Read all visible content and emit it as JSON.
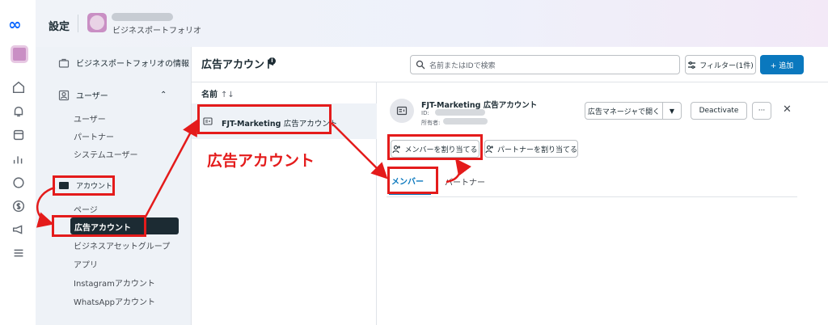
{
  "header": {
    "title": "設定",
    "business_name": "ビジネスポートフォリオ"
  },
  "rail": {
    "icons": [
      "meta-logo-icon",
      "home-icon",
      "bell-icon",
      "pages-icon",
      "chart-icon",
      "chat-icon",
      "dollar-icon",
      "megaphone-icon",
      "menu-icon"
    ]
  },
  "sidebar": {
    "business_info": "ビジネスポートフォリオの情報",
    "users": {
      "label": "ユーザー",
      "items": [
        "ユーザー",
        "パートナー",
        "システムユーザー"
      ]
    },
    "accounts": {
      "label": "アカウント",
      "items": [
        "ページ",
        "広告アカウント",
        "ビジネスアセットグループ",
        "アプリ",
        "Instagramアカウント",
        "WhatsAppアカウント"
      ]
    }
  },
  "main": {
    "title": "広告アカウント",
    "search_placeholder": "名前またはIDで検索",
    "filter_label": "フィルター(1件)",
    "add_label": "+ 追加",
    "list_header": "名前",
    "list_sort": "↑↓",
    "list_item_name": "FJT-Marketing",
    "list_item_suffix": "広告アカウント"
  },
  "detail": {
    "name": "FJT-Marketing 広告アカウント",
    "id_label": "ID:",
    "owner_label": "所有者:",
    "open_ads_manager": "広告マネージャで開く",
    "dropdown": "▼",
    "deactivate": "Deactivate",
    "more": "···",
    "close": "✕",
    "assign_members": "メンバーを割り当てる",
    "assign_partners": "パートナーを割り当てる",
    "tab_members": "メンバー",
    "tab_partners": "パートナー"
  },
  "annotation": {
    "label": "広告アカウント",
    "color": "#e41b1b"
  }
}
